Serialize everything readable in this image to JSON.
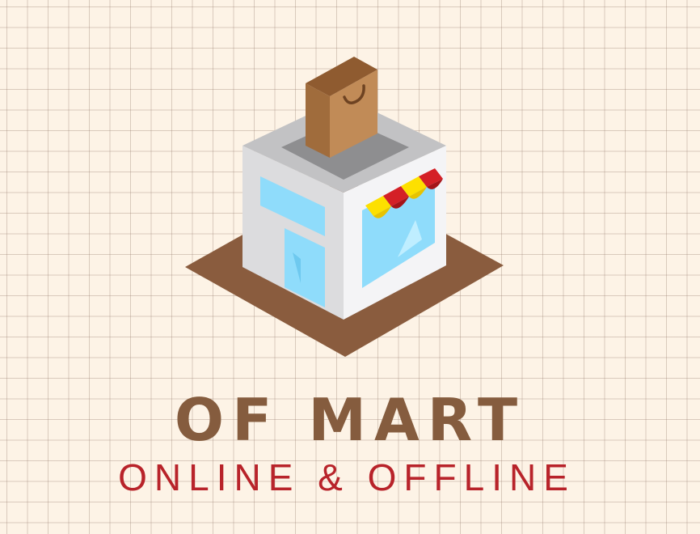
{
  "logo": {
    "icon": "storefront-with-shopping-bag-icon",
    "colors": {
      "background": "#fdf3e6",
      "grid": "#967d6e",
      "ground": "#8a5c3e",
      "bag": "#b5804c",
      "walls": "#f2f2f4",
      "roof": "#bdbdbf",
      "windows": "#8fdcfb",
      "awning_red": "#d42026",
      "awning_yellow": "#fde000"
    }
  },
  "brand": {
    "name": "OF MART",
    "name_color": "#855c3e",
    "tagline": "ONLINE & OFFLINE",
    "tagline_color": "#b8232a"
  }
}
